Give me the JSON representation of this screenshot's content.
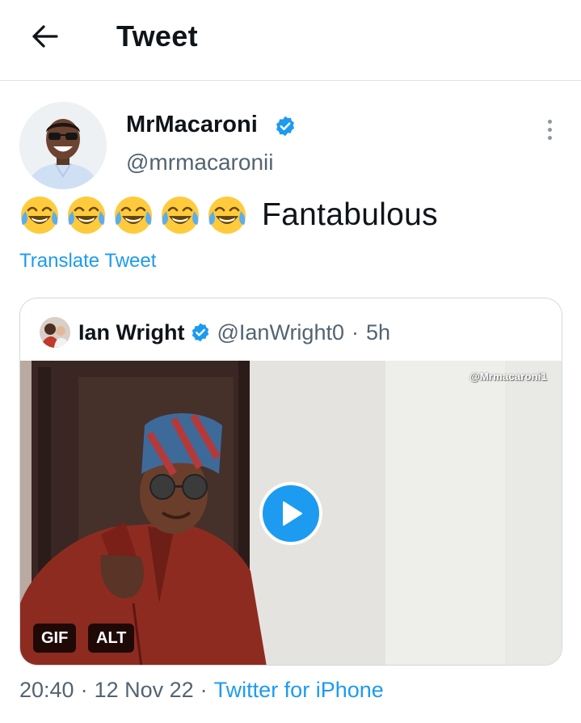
{
  "header": {
    "title": "Tweet",
    "back_icon": "arrow-left-icon"
  },
  "tweet": {
    "author": {
      "name": "MrMacaroni",
      "handle": "@mrmacaronii",
      "verified": true
    },
    "emoji": [
      "😂",
      "😂",
      "😂",
      "😂",
      "😂"
    ],
    "text": "Fantabulous",
    "translate_label": "Translate Tweet",
    "timestamp": {
      "time": "20:40",
      "date": "12 Nov 22",
      "source": "Twitter for iPhone"
    }
  },
  "quoted_tweet": {
    "name": "Ian Wright",
    "handle": "@IanWright0",
    "separator": "·",
    "age": "5h",
    "verified": true,
    "media": {
      "watermark": "@Mrmacaroni1",
      "gif_badge": "GIF",
      "alt_badge": "ALT",
      "play_icon": "play-icon"
    }
  },
  "colors": {
    "accent": "#1d9bf0",
    "text": "#0f1419",
    "muted": "#536471",
    "border": "#cfd9de"
  }
}
